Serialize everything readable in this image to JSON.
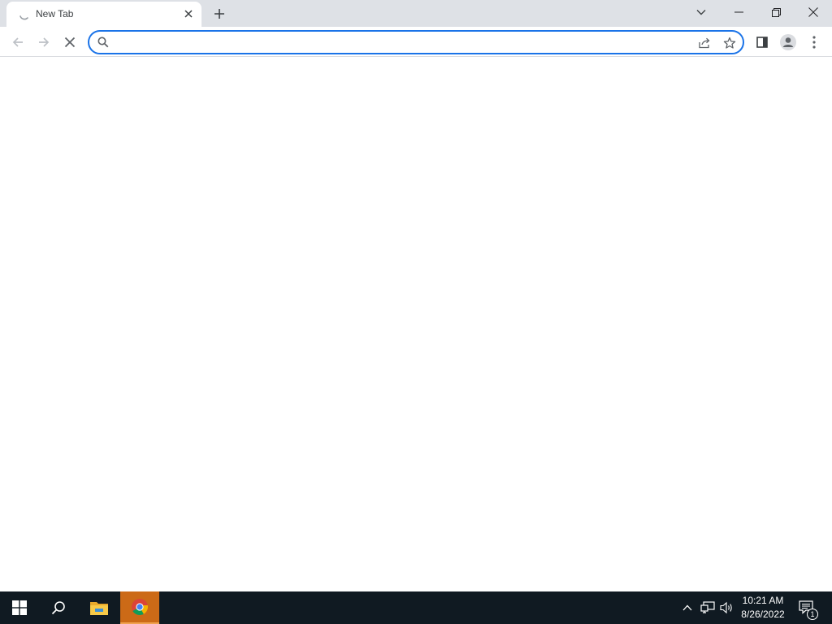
{
  "browser": {
    "tab": {
      "title": "New Tab",
      "loading": true
    },
    "omnibox": {
      "value": "",
      "placeholder": ""
    },
    "accent_color": "#1a73e8"
  },
  "taskbar": {
    "clock": {
      "time": "10:21 AM",
      "date": "8/26/2022"
    },
    "notification_count": "1",
    "pinned": [
      "start-icon",
      "search-icon",
      "file-explorer-icon",
      "chrome-icon"
    ]
  }
}
